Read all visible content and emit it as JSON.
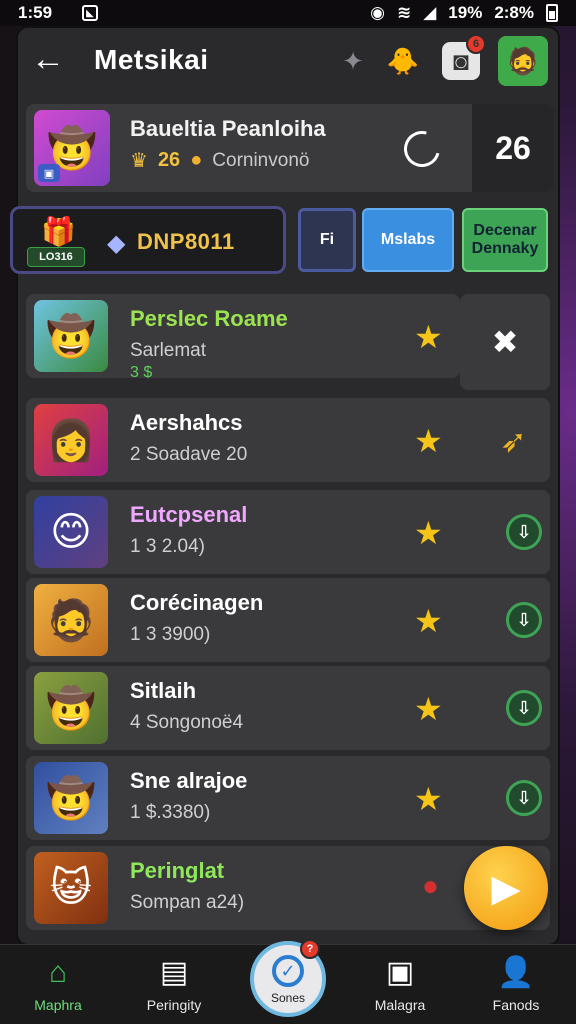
{
  "status_bar": {
    "time": "1:59",
    "battery": "19%",
    "clock": "2:8%"
  },
  "header": {
    "title": "Metsikai",
    "badge_count": "6"
  },
  "profile": {
    "name": "Baueltia Peanloiha",
    "level": "26",
    "subtitle": "Corninvonö"
  },
  "profile_right": "26",
  "balance": {
    "chest_label": "LO316",
    "code": "DNP8011"
  },
  "actions": [
    {
      "label": "Fi"
    },
    {
      "label": "Mslabs"
    },
    {
      "label": "Decenar Dennaky"
    }
  ],
  "games": [
    {
      "title": "Perslec Roame",
      "subtitle": "Sarlemat",
      "meta": "3 $",
      "title_color": "#9be44f"
    },
    {
      "title": "Aershahcs",
      "subtitle": "2 Soadave 20",
      "title_color": "#ffffff"
    },
    {
      "title": "Eutcpsenal",
      "subtitle": "1 3 2.04)",
      "title_color": "#f0a7ff"
    },
    {
      "title": "Corécinagen",
      "subtitle": "1 3 3900)",
      "title_color": "#ffffff"
    },
    {
      "title": "Sitlaih",
      "subtitle": "4 Songonoë4",
      "title_color": "#ffffff"
    },
    {
      "title": "Sne alrajoe",
      "subtitle": "1 $.3380)",
      "title_color": "#ffffff"
    },
    {
      "title": "Peringlat",
      "subtitle": "Sompan a24)",
      "title_color": "#8ee85a"
    }
  ],
  "nav": [
    {
      "label": "Maphra"
    },
    {
      "label": "Peringity"
    },
    {
      "label": "Sones"
    },
    {
      "label": "Malagra"
    },
    {
      "label": "Fanods"
    }
  ],
  "colors": {
    "accent_blue": "#3b8fe0",
    "accent_green": "#3ea455",
    "star": "#f5c518",
    "play": "#f29a0f"
  },
  "icons": [
    "back-arrow-icon",
    "sparkle-icon",
    "duck-icon",
    "camera-icon",
    "profile-avatar",
    "star-icon",
    "download-icon",
    "play-icon",
    "home-icon",
    "gallery-icon",
    "user-icon"
  ]
}
